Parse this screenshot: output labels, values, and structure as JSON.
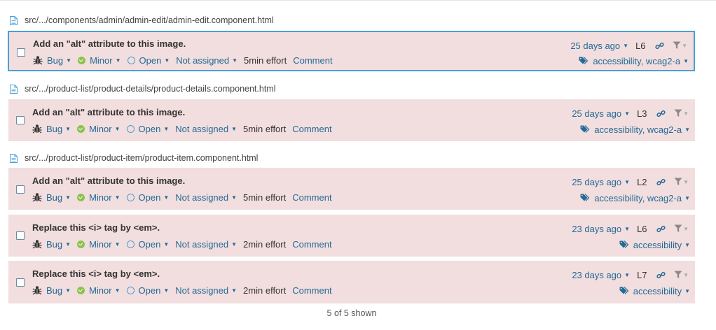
{
  "files": [
    {
      "path": "src/.../components/admin/admin-edit/admin-edit.component.html",
      "issues": [
        {
          "message": "Add an \"alt\" attribute to this image.",
          "type": "Bug",
          "severity": "Minor",
          "status": "Open",
          "assignee": "Not assigned",
          "effort": "5min effort",
          "comment": "Comment",
          "date": "25 days ago",
          "line": "L6",
          "tags": "accessibility, wcag2-a"
        }
      ]
    },
    {
      "path": "src/.../product-list/product-details/product-details.component.html",
      "issues": [
        {
          "message": "Add an \"alt\" attribute to this image.",
          "type": "Bug",
          "severity": "Minor",
          "status": "Open",
          "assignee": "Not assigned",
          "effort": "5min effort",
          "comment": "Comment",
          "date": "25 days ago",
          "line": "L3",
          "tags": "accessibility, wcag2-a"
        }
      ]
    },
    {
      "path": "src/.../product-list/product-item/product-item.component.html",
      "issues": [
        {
          "message": "Add an \"alt\" attribute to this image.",
          "type": "Bug",
          "severity": "Minor",
          "status": "Open",
          "assignee": "Not assigned",
          "effort": "5min effort",
          "comment": "Comment",
          "date": "25 days ago",
          "line": "L2",
          "tags": "accessibility, wcag2-a"
        },
        {
          "message": "Replace this <i> tag by <em>.",
          "type": "Bug",
          "severity": "Minor",
          "status": "Open",
          "assignee": "Not assigned",
          "effort": "2min effort",
          "comment": "Comment",
          "date": "23 days ago",
          "line": "L6",
          "tags": "accessibility"
        },
        {
          "message": "Replace this <i> tag by <em>.",
          "type": "Bug",
          "severity": "Minor",
          "status": "Open",
          "assignee": "Not assigned",
          "effort": "2min effort",
          "comment": "Comment",
          "date": "23 days ago",
          "line": "L7",
          "tags": "accessibility"
        }
      ]
    }
  ],
  "footer": {
    "shown": "5 of 5 shown"
  },
  "colors": {
    "issue_bg": "#f2dede",
    "link": "#236a97",
    "selected_border": "#4b9fd5",
    "minor": "#8bc34a"
  }
}
